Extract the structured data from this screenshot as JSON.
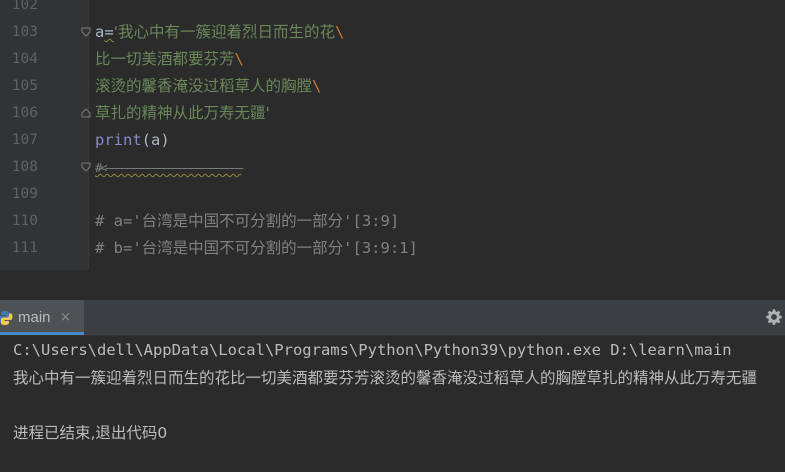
{
  "editor": {
    "lines": [
      {
        "num": "102",
        "code": ""
      },
      {
        "num": "103",
        "var": "a",
        "op": "=",
        "str": "'我心中有一簇迎着烈日而生的花",
        "esc": "\\"
      },
      {
        "num": "104",
        "str": "比一切美酒都要芬芳",
        "esc": "\\"
      },
      {
        "num": "105",
        "str": "滚烫的馨香淹没过稻草人的胸膛",
        "esc": "\\"
      },
      {
        "num": "106",
        "str": "草扎的精神从此万寿无疆'"
      },
      {
        "num": "107",
        "fn": "print",
        "args": "(a)"
      },
      {
        "num": "108",
        "comment": "#<——————————————————————————"
      },
      {
        "num": "109",
        "code": ""
      },
      {
        "num": "110",
        "comment": "# a='台湾是中国不可分割的一部分'[3:9]"
      },
      {
        "num": "111",
        "comment": "# b='台湾是中国不可分割的一部分'[3:9:1]"
      }
    ]
  },
  "run_panel": {
    "tab_label": "main",
    "close_glyph": "×",
    "output": [
      "C:\\Users\\dell\\AppData\\Local\\Programs\\Python\\Python39\\python.exe D:\\learn\\main",
      "我心中有一簇迎着烈日而生的花比一切美酒都要芬芳滚烫的馨香淹没过稻草人的胸膛草扎的精神从此万寿无疆",
      "",
      "进程已结束,退出代码0"
    ]
  },
  "icons": {
    "fold": "fold-marker-icon",
    "tab": "python-icon",
    "close": "close-icon",
    "settings": "gear-icon"
  },
  "colors": {
    "background": "#2b2b2b",
    "string": "#6a8759",
    "escape": "#cc7832",
    "builtin": "#8888c6",
    "comment": "#808080",
    "line_number": "#606366"
  }
}
